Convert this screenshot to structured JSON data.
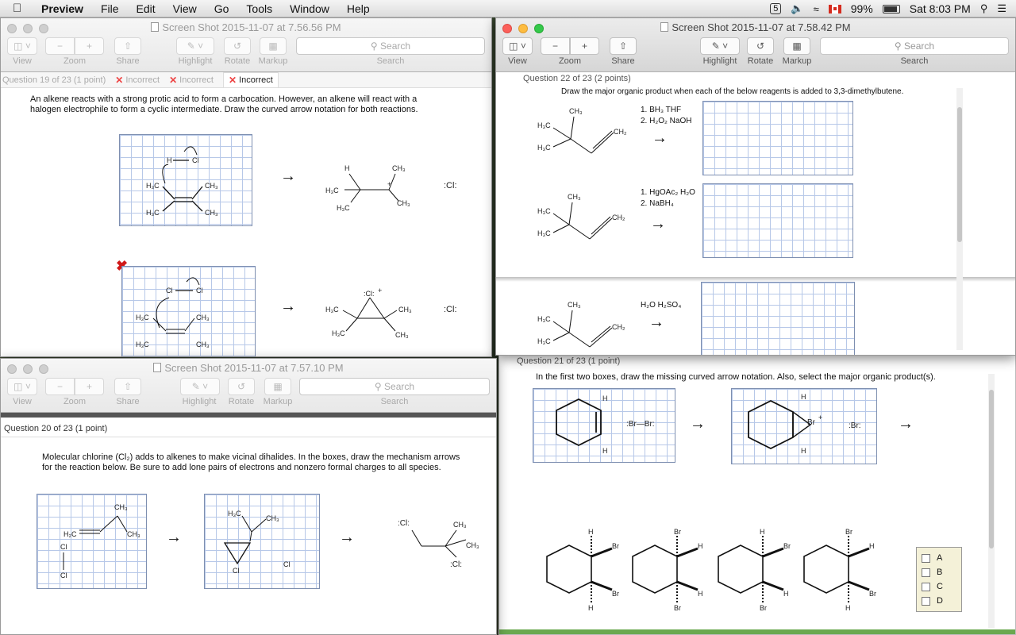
{
  "menubar": {
    "app_name": "Preview",
    "items": [
      "File",
      "Edit",
      "View",
      "Go",
      "Tools",
      "Window",
      "Help"
    ],
    "battery": "99%",
    "clock": "Sat 8:03 PM",
    "badge": "5"
  },
  "toolbar": {
    "view": "View",
    "zoom": "Zoom",
    "share": "Share",
    "highlight": "Highlight",
    "rotate": "Rotate",
    "markup": "Markup",
    "search_placeholder": "Search",
    "search_label": "Search"
  },
  "win1": {
    "title": "Screen Shot 2015-11-07 at 7.56.56 PM",
    "qnum": "Question 19 of 23 (1 point)",
    "tabs": [
      "Incorrect",
      "Incorrect",
      "Incorrect"
    ],
    "prompt": "An alkene reacts with a strong protic acid to form a carbocation. However, an alkene will react with a halogen electrophile to form a cyclic intermediate. Draw the curved arrow notation for both reactions."
  },
  "win2": {
    "title": "Screen Shot 2015-11-07 at 7.58.42 PM",
    "qnum": "Question 22 of 23 (2 points)",
    "prompt": "Draw the major organic product when each of the below reagents is added to 3,3-dimethylbutene.",
    "reagents1": [
      "1. BH₃ THF",
      "2. H₂O₂ NaOH"
    ],
    "reagents2": [
      "1. HgOAc₂ H₂O",
      "2. NaBH₄"
    ],
    "reagents3": "H₂O  H₂SO₄"
  },
  "win3": {
    "title": "Screen Shot 2015-11-07 at 7.57.10 PM",
    "qnum": "Question 20 of 23 (1 point)",
    "prompt": "Molecular chlorine (Cl₂) adds to alkenes to make vicinal dihalides.  In the boxes, draw the mechanism arrows for the reaction below. Be sure to add lone pairs of electrons and nonzero formal charges to all species."
  },
  "win4": {
    "qnum": "Question 21 of 23 (1 point)",
    "prompt": "In the first two boxes, draw the missing curved arrow notation. Also, select the major organic product(s).",
    "choices": [
      "A",
      "B",
      "C",
      "D"
    ]
  },
  "colors": {
    "incorrect": "#e44444",
    "grid": "#b7c8e8",
    "accent": "#34c84a"
  }
}
